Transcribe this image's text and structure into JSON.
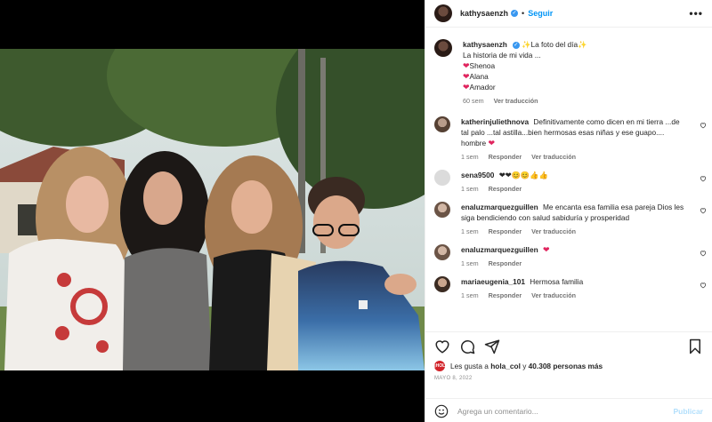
{
  "header": {
    "username": "kathysaenzh",
    "separator": "•",
    "follow_label": "Seguir",
    "more_label": "•••"
  },
  "caption": {
    "username": "kathysaenzh",
    "line1_after": "La foto del día",
    "line2": "La historia de mi vida ...",
    "names": [
      "Shenoa",
      "Alana",
      "Amador"
    ],
    "time": "60 sem",
    "translate_label": "Ver traducción"
  },
  "comments": [
    {
      "username": "katherinjuliethnova",
      "text": "Definitivamente como dicen en mi tierra ...de tal palo ...tal astilla...bien hermosas esas niñas y ese guapo.... hombre",
      "trailing": "❤",
      "time": "1 sem",
      "reply_label": "Responder",
      "translate_label": "Ver traducción",
      "avatar": "photo"
    },
    {
      "username": "sena9500",
      "text": "",
      "trailing": "❤❤😊😊👍👍",
      "time": "1 sem",
      "reply_label": "Responder",
      "translate_label": "",
      "avatar": "default"
    },
    {
      "username": "enaluzmarquezguillen",
      "text": "Me encanta esa familia esa pareja Dios les siga bendiciendo con salud sabiduría y prosperidad",
      "trailing": "",
      "time": "1 sem",
      "reply_label": "Responder",
      "translate_label": "Ver traducción",
      "avatar": "photo"
    },
    {
      "username": "enaluzmarquezguillen",
      "text": "",
      "trailing": "❤",
      "time": "1 sem",
      "reply_label": "Responder",
      "translate_label": "",
      "avatar": "photo"
    },
    {
      "username": "mariaeugenia_101",
      "text": "Hermosa familia",
      "trailing": "",
      "time": "1 sem",
      "reply_label": "Responder",
      "translate_label": "Ver traducción",
      "avatar": "photo"
    }
  ],
  "likes": {
    "prefix": "Les gusta a",
    "liker": "hola_col",
    "middle": "y",
    "count_text": "40.308 personas más",
    "liker_badge": "¡HOLA!"
  },
  "date": "MAYO 8, 2022",
  "add_comment": {
    "placeholder": "Agrega un comentario...",
    "publish_label": "Publicar"
  },
  "icons": [
    "heart-icon",
    "comment-icon",
    "share-icon",
    "bookmark-icon",
    "emoji-icon",
    "more-icon",
    "verified-icon"
  ],
  "colors": {
    "accent": "#0095f6",
    "verified": "#3897f0",
    "heart": "#e0245e",
    "publish_disabled": "#b2dffc"
  }
}
